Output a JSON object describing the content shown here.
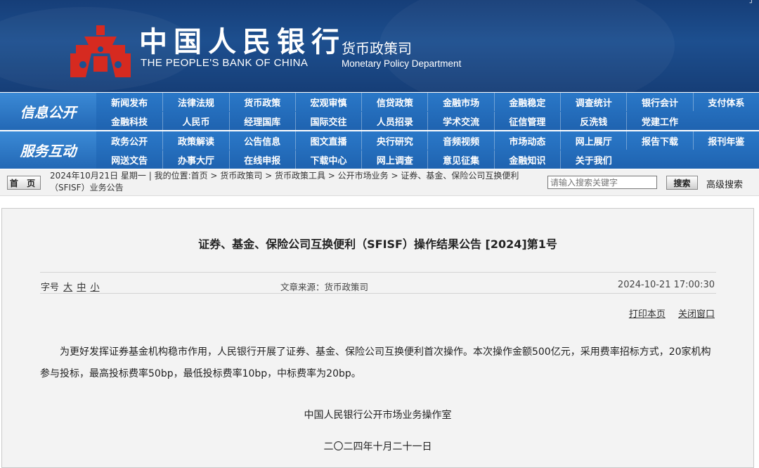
{
  "header": {
    "brand_cn": "中国人民银行",
    "brand_en": "THE PEOPLE'S BANK OF CHINA",
    "dept_cn": "货币政策司",
    "dept_en": "Monetary Policy Department",
    "logo_icon": "pboc-emblem-icon",
    "colors": {
      "banner": "#1d4f8f",
      "emblem": "#d62a20",
      "nav": "#2368b5"
    }
  },
  "nav": {
    "group1": {
      "title": "信息公开",
      "row1": [
        "新闻发布",
        "法律法规",
        "货币政策",
        "宏观审慎",
        "信贷政策",
        "金融市场",
        "金融稳定",
        "调查统计",
        "银行会计",
        "支付体系"
      ],
      "row2": [
        "金融科技",
        "人民币",
        "经理国库",
        "国际交往",
        "人员招录",
        "学术交流",
        "征信管理",
        "反洗钱",
        "党建工作"
      ]
    },
    "group2": {
      "title": "服务互动",
      "row1": [
        "政务公开",
        "政策解读",
        "公告信息",
        "图文直播",
        "央行研究",
        "音频视频",
        "市场动态",
        "网上展厅",
        "报告下载",
        "报刊年鉴"
      ],
      "row2": [
        "网送文告",
        "办事大厅",
        "在线申报",
        "下载中心",
        "网上调查",
        "意见征集",
        "金融知识",
        "关于我们"
      ]
    }
  },
  "crumb": {
    "home_label": "首 页",
    "text": "2024年10月21日 星期一 | 我的位置:首页 > 货币政策司 > 货币政策工具 > 公开市场业务 > 证券、基金、保险公司互换便利（SFISF）业务公告",
    "search_placeholder": "请输入搜索关键字",
    "search_label": "搜索",
    "advanced_label": "高级搜索"
  },
  "article": {
    "title": "证券、基金、保险公司互换便利（SFISF）操作结果公告 [2024]第1号",
    "fontsize_label": "字号",
    "fontsize_large": "大",
    "fontsize_medium": "中",
    "fontsize_small": "小",
    "source": "文章来源：货币政策司",
    "time": "2024-10-21 17:00:30",
    "print_label": "打印本页",
    "close_label": "关闭窗口",
    "body": "为更好发挥证券基金机构稳市作用，人民银行开展了证券、基金、保险公司互换便利首次操作。本次操作金额500亿元，采用费率招标方式，20家机构参与投标，最高投标费率50bp，最低投标费率10bp，中标费率为20bp。",
    "signer": "中国人民银行公开市场业务操作室",
    "date": "二〇二四年十月二十一日"
  }
}
